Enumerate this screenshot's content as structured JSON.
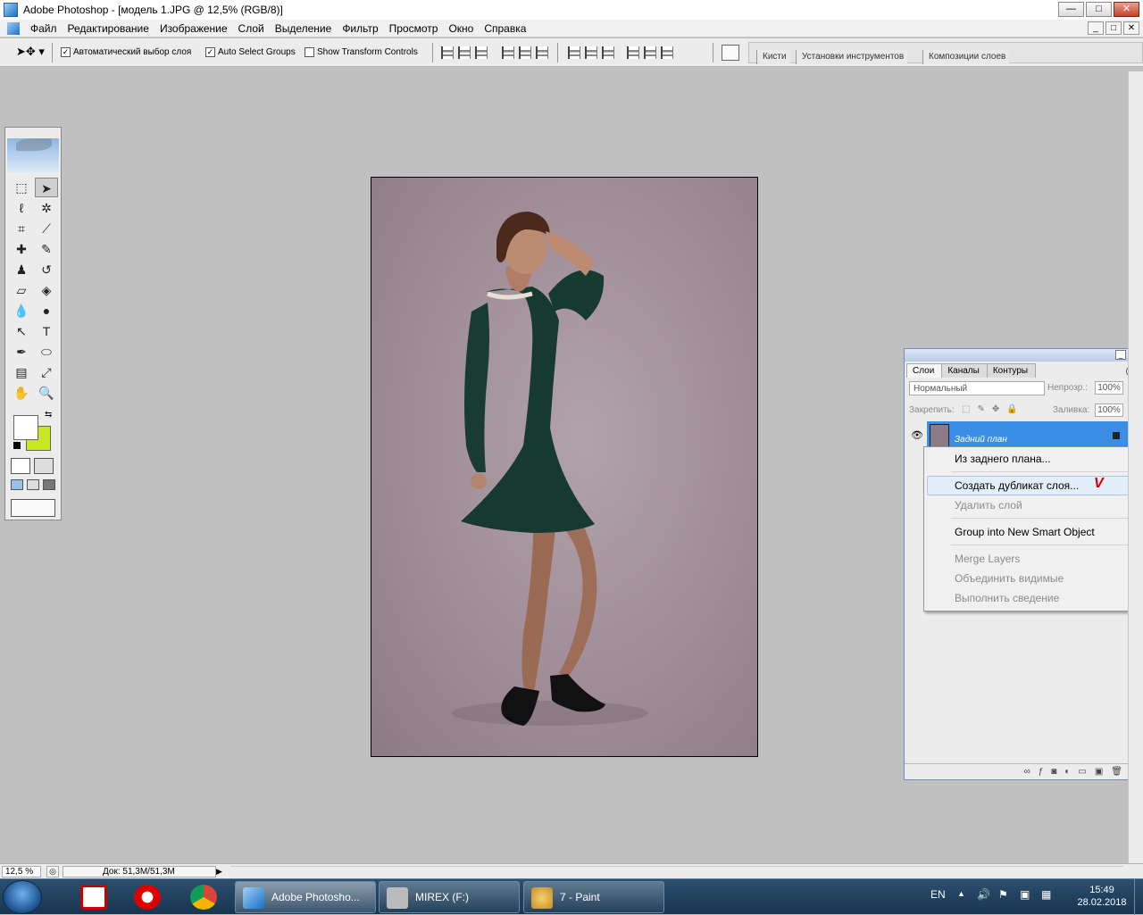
{
  "window": {
    "title": "Adobe Photoshop - [модель 1.JPG @ 12,5% (RGB/8)]",
    "buttons": {
      "minimize": "—",
      "maximize": "□",
      "close": "✕"
    }
  },
  "menu": [
    "Файл",
    "Редактирование",
    "Изображение",
    "Слой",
    "Выделение",
    "Фильтр",
    "Просмотр",
    "Окно",
    "Справка"
  ],
  "options": {
    "auto_select_layer": {
      "label": "Автоматический выбор слоя",
      "checked": true
    },
    "auto_select_groups": {
      "label": "Auto Select Groups",
      "checked": true
    },
    "show_transform": {
      "label": "Show Transform Controls",
      "checked": false
    }
  },
  "palette_well": [
    "Кисти",
    "Установки инструментов",
    "Композиции слоев"
  ],
  "colors": {
    "foreground": "#ffffff",
    "background": "#c6e820",
    "accent": "#3a8ee6"
  },
  "layers_panel": {
    "tabs": [
      "Слои",
      "Каналы",
      "Контуры"
    ],
    "active_tab": "Слои",
    "blend_mode": "Нормальный",
    "opacity_label": "Непрозр.:",
    "opacity": "100%",
    "lock_label": "Закрепить:",
    "fill_label": "Заливка:",
    "fill": "100%",
    "layer_name": "Задний план"
  },
  "context_menu": {
    "items": [
      {
        "label": "Из заднего плана...",
        "enabled": true
      },
      {
        "label": "Создать дубликат слоя...",
        "enabled": true,
        "hovered": true
      },
      {
        "label": "Удалить слой",
        "enabled": false
      },
      {
        "label": "Group into New Smart Object",
        "enabled": true
      },
      {
        "label": "Merge Layers",
        "enabled": false
      },
      {
        "label": "Объединить видимые",
        "enabled": false
      },
      {
        "label": "Выполнить сведение",
        "enabled": false
      }
    ],
    "mark": "V"
  },
  "status": {
    "zoom": "12,5 %",
    "doc": "Док: 51,3M/51,3M"
  },
  "taskbar": {
    "tasks": [
      "Adobe Photosho...",
      "MIREX (F:)",
      "7 - Paint"
    ],
    "lang": "EN",
    "time": "15:49",
    "date": "28.02.2018"
  }
}
